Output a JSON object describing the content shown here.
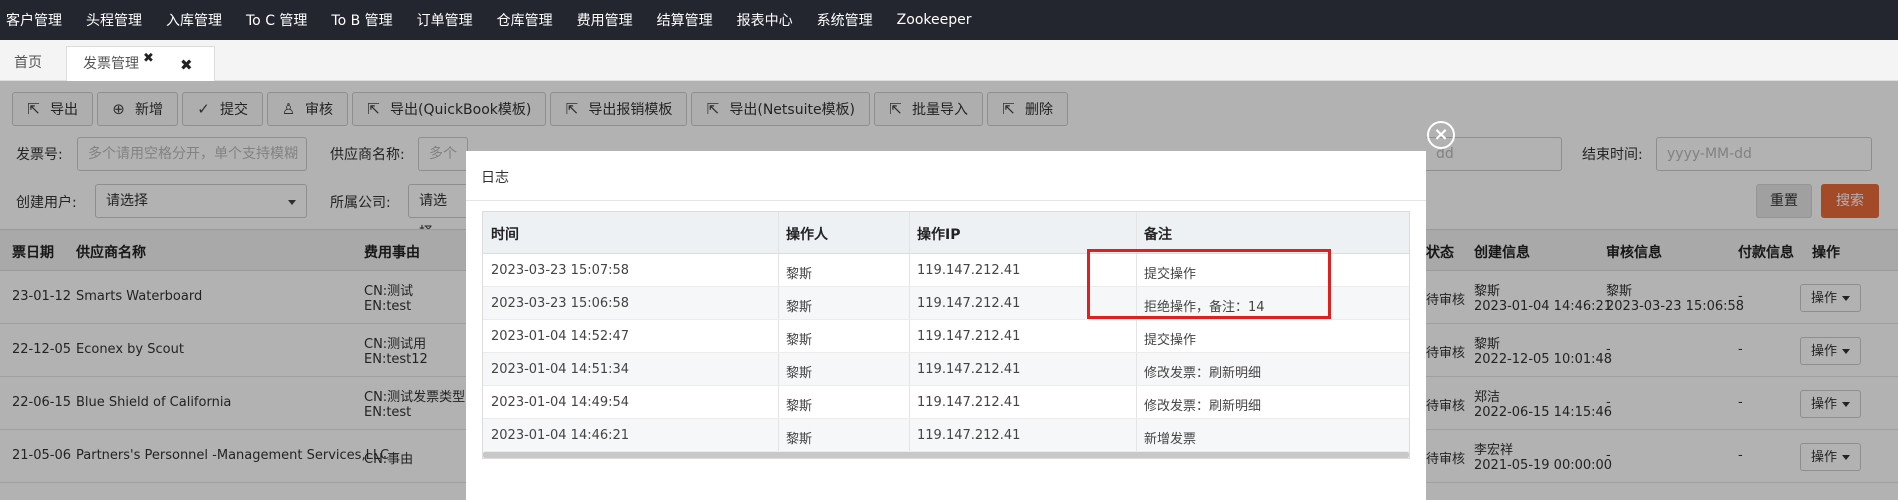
{
  "nav": [
    "客户管理",
    "头程管理",
    "入库管理",
    "To C 管理",
    "To B 管理",
    "订单管理",
    "仓库管理",
    "费用管理",
    "结算管理",
    "报表中心",
    "系统管理",
    "Zookeeper"
  ],
  "tabs": {
    "home": "首页",
    "active": "发票管理",
    "tab_close_glyph": "✖",
    "close_glyph": "✖"
  },
  "toolbar": {
    "export": "导出",
    "add": "新增",
    "submit": "提交",
    "audit": "审核",
    "export_quickbook": "导出(QuickBook模板)",
    "export_reimburse": "导出报销模板",
    "export_netsuite": "导出(Netsuite模板)",
    "batch_import": "批量导入",
    "delete": "删除"
  },
  "filters": {
    "invoice_no_label": "发票号:",
    "invoice_no_placeholder": "多个请用空格分开，单个支持模糊",
    "supplier_label": "供应商名称:",
    "supplier_placeholder": "多个",
    "end_time_label": "结束时间:",
    "date_placeholder": "yyyy-MM-dd",
    "start_fragment": "dd",
    "creator_label": "创建用户:",
    "creator_value": "请选择",
    "company_label": "所属公司:",
    "company_value": "请选择",
    "reset": "重置",
    "search": "搜索"
  },
  "grid": {
    "headers": {
      "date": "票日期",
      "supplier": "供应商名称",
      "reason": "费用事由",
      "status": "状态",
      "created": "创建信息",
      "audit": "审核信息",
      "payment": "付款信息",
      "ops": "操作"
    },
    "rows": [
      {
        "date": "23-01-12",
        "supplier": "Smarts Waterboard",
        "cn": "CN:测试",
        "en": "EN:test",
        "status": "待审核",
        "creator": "黎斯",
        "created_at": "2023-01-04 14:46:21",
        "auditor": "黎斯",
        "audited_at": "2023-03-23 15:06:58",
        "payment": "-",
        "op": "操作"
      },
      {
        "date": "22-12-05",
        "supplier": "Econex by Scout",
        "cn": "CN:测试用",
        "en": "EN:test12",
        "status": "待审核",
        "creator": "黎斯",
        "created_at": "2022-12-05 10:01:48",
        "auditor": "-",
        "audited_at": "",
        "payment": "-",
        "op": "操作"
      },
      {
        "date": "22-06-15",
        "supplier": "Blue Shield of California",
        "cn": "CN:测试发票类型",
        "en": "EN:test",
        "status": "待审核",
        "creator": "郑洁",
        "created_at": "2022-06-15 14:15:46",
        "auditor": "-",
        "audited_at": "",
        "payment": "-",
        "op": "操作"
      },
      {
        "date": "21-05-06",
        "supplier": "Partners's Personnel -Management Services,LLC",
        "cn": "CN:事由",
        "en": "",
        "status": "待审核",
        "creator": "李宏祥",
        "created_at": "2021-05-19 00:00:00",
        "auditor": "-",
        "audited_at": "",
        "payment": "-",
        "op": "操作"
      }
    ]
  },
  "modal": {
    "title": "日志",
    "close_glyph": "×",
    "headers": {
      "time": "时间",
      "operator": "操作人",
      "ip": "操作IP",
      "note": "备注"
    },
    "rows": [
      {
        "time": "2023-03-23 15:07:58",
        "operator": "黎斯",
        "ip": "119.147.212.41",
        "note": "提交操作"
      },
      {
        "time": "2023-03-23 15:06:58",
        "operator": "黎斯",
        "ip": "119.147.212.41",
        "note": "拒绝操作，备注：14"
      },
      {
        "time": "2023-01-04 14:52:47",
        "operator": "黎斯",
        "ip": "119.147.212.41",
        "note": "提交操作"
      },
      {
        "time": "2023-01-04 14:51:34",
        "operator": "黎斯",
        "ip": "119.147.212.41",
        "note": "修改发票：刷新明细"
      },
      {
        "time": "2023-01-04 14:49:54",
        "operator": "黎斯",
        "ip": "119.147.212.41",
        "note": "修改发票：刷新明细"
      },
      {
        "time": "2023-01-04 14:46:21",
        "operator": "黎斯",
        "ip": "119.147.212.41",
        "note": "新增发票"
      }
    ]
  },
  "colors": {
    "nav_bg": "#23262e",
    "search_btn": "#ea6a3c",
    "highlight": "#e02020"
  }
}
